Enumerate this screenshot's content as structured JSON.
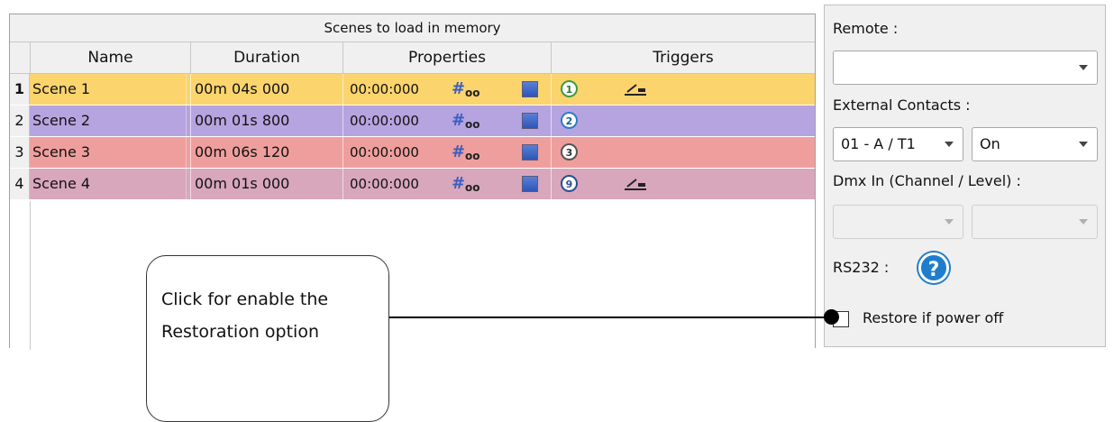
{
  "table": {
    "title": "Scenes to load in memory",
    "columns": [
      "Name",
      "Duration",
      "Properties",
      "Triggers"
    ],
    "rows": [
      {
        "num": "1",
        "name": "Scene 1",
        "duration": "00m 04s 000",
        "time": "00:00:000",
        "trigger_num": "1",
        "has_switch": true,
        "color": "#fbd46e"
      },
      {
        "num": "2",
        "name": "Scene 2",
        "duration": "00m 01s 800",
        "time": "00:00:000",
        "trigger_num": "2",
        "has_switch": false,
        "color": "#b6a4e0"
      },
      {
        "num": "3",
        "name": "Scene 3",
        "duration": "00m 06s 120",
        "time": "00:00:000",
        "trigger_num": "3",
        "has_switch": false,
        "color": "#ee9f9d"
      },
      {
        "num": "4",
        "name": "Scene 4",
        "duration": "00m 01s 000",
        "time": "00:00:000",
        "trigger_num": "9",
        "has_switch": true,
        "color": "#d8a7bc"
      }
    ]
  },
  "settings": {
    "remote_label": "Remote :",
    "remote_value": "",
    "external_contacts_label": "External Contacts :",
    "contact_value": "01 - A / T1",
    "state_value": "On",
    "dmx_label": "Dmx In (Channel / Level) :",
    "rs232_label": "RS232 :",
    "restore_label": "Restore if power off"
  },
  "callout": {
    "line1": "Click for enable the",
    "line2": "Restoration option"
  },
  "colors": {
    "help_blue": "#1f7dcc"
  }
}
